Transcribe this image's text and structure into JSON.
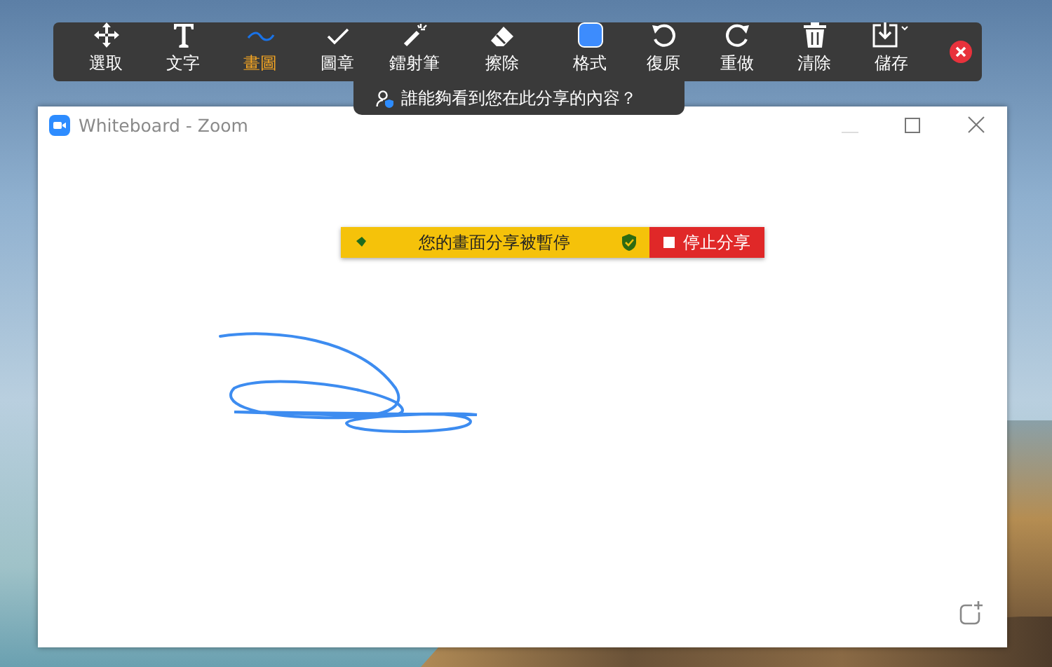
{
  "toolbar": {
    "tools": [
      {
        "label": "選取",
        "selected": false
      },
      {
        "label": "文字",
        "selected": false
      },
      {
        "label": "畫圖",
        "selected": true
      },
      {
        "label": "圖章",
        "selected": false
      },
      {
        "label": "鐳射筆",
        "selected": false
      },
      {
        "label": "擦除",
        "selected": false
      },
      {
        "label": "格式",
        "selected": false
      },
      {
        "label": "復原",
        "selected": false
      },
      {
        "label": "重做",
        "selected": false
      },
      {
        "label": "清除",
        "selected": false
      },
      {
        "label": "儲存",
        "selected": false
      }
    ]
  },
  "tooltip": {
    "text": "誰能夠看到您在此分享的內容？"
  },
  "window": {
    "title": "Whiteboard - Zoom"
  },
  "share_banner": {
    "message": "您的畫面分享被暫停",
    "stop_button": "停止分享"
  }
}
